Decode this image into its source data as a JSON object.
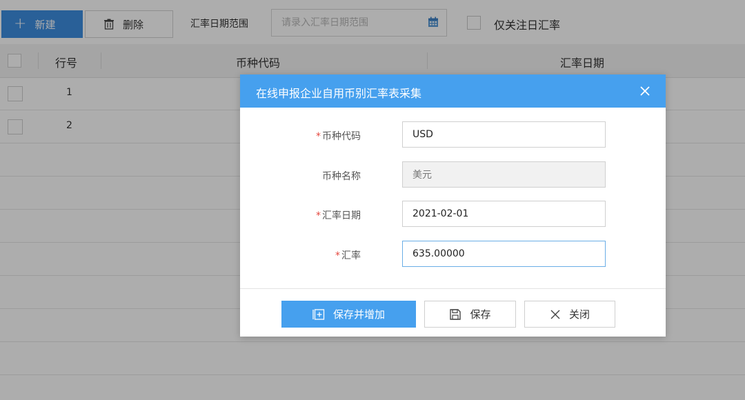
{
  "toolbar": {
    "new_label": "新建",
    "delete_label": "删除",
    "date_range_label": "汇率日期范围",
    "date_range_placeholder": "请录入汇率日期范围",
    "only_daily_label": "仅关注日汇率"
  },
  "table": {
    "columns": [
      "行号",
      "币种代码",
      "汇率日期"
    ],
    "rows": [
      {
        "num": "1"
      },
      {
        "num": "2"
      }
    ]
  },
  "dialog": {
    "title": "在线申报企业自用币别汇率表采集",
    "fields": {
      "currency_code": {
        "label": "币种代码",
        "value": "USD",
        "required": true
      },
      "currency_name": {
        "label": "币种名称",
        "value": "美元",
        "required": false
      },
      "rate_date": {
        "label": "汇率日期",
        "value": "2021-02-01",
        "required": true
      },
      "rate": {
        "label": "汇率",
        "value": "635.00000",
        "required": true
      }
    },
    "buttons": {
      "save_and_add": "保存并增加",
      "save": "保存",
      "close": "关闭"
    },
    "required_mark": "*"
  },
  "colors": {
    "accent": "#46a0ee",
    "primary_button": "#3d8ee0",
    "required": "#e5483f"
  }
}
